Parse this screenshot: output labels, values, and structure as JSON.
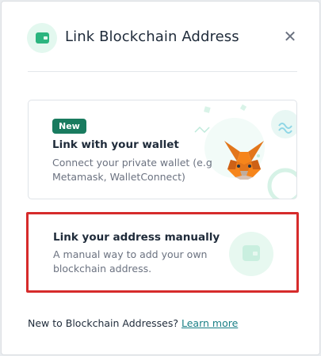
{
  "header": {
    "title": "Link Blockchain Address",
    "close_label": "✕",
    "icon": "wallet-icon"
  },
  "options": [
    {
      "badge": "New",
      "title": "Link with your wallet",
      "description": "Connect your private wallet (e.g Metamask, WalletConnect)",
      "icon": "metamask-fox-icon"
    },
    {
      "title": "Link your address manually",
      "description": "A manual way to add your own blockchain address.",
      "icon": "wallet-icon"
    }
  ],
  "footer": {
    "text": "New to Blockchain Addresses? ",
    "link_label": "Learn more"
  },
  "colors": {
    "accent": "#197b5f",
    "link": "#1a7f86",
    "highlight_border": "#d62b2b"
  }
}
